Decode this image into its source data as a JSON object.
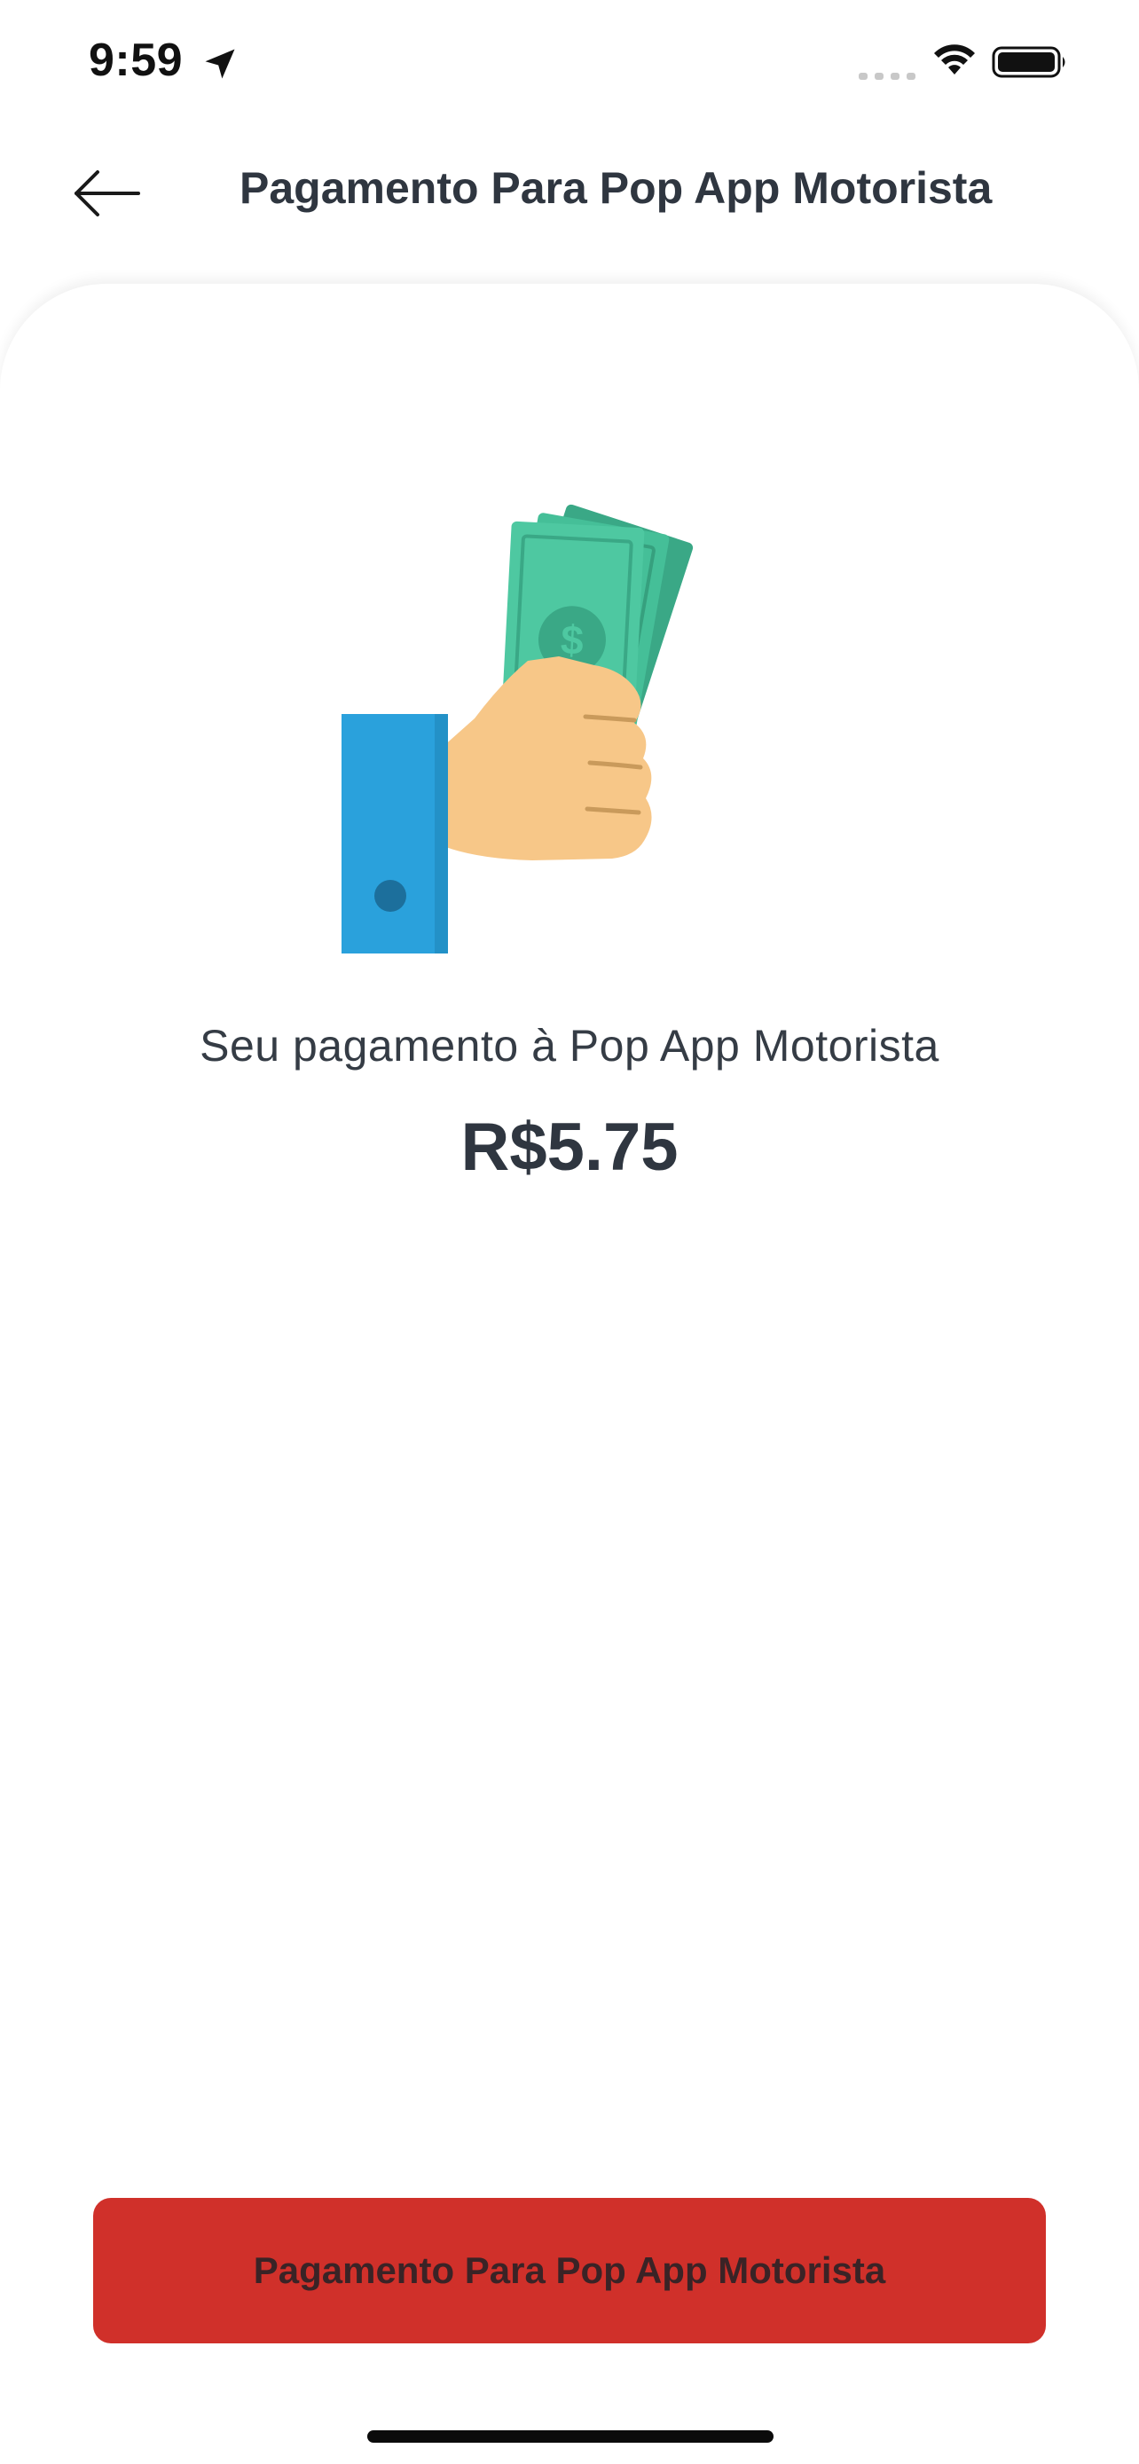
{
  "status_bar": {
    "time": "9:59",
    "location_icon": "location-arrow-icon",
    "signal_icon": "cellular-signal-icon",
    "wifi_icon": "wifi-icon",
    "battery_icon": "battery-icon"
  },
  "header": {
    "back_icon": "arrow-left-icon",
    "title": "Pagamento Para Pop App Motorista"
  },
  "payment": {
    "illustration_icon": "hand-holding-money-icon",
    "subtitle": "Seu pagamento à Pop App Motorista",
    "amount": "R$5.75"
  },
  "footer": {
    "button_label": "Pagamento Para Pop App Motorista"
  },
  "colors": {
    "accent": "#d0302a",
    "text": "#2f3640",
    "background": "#ffffff"
  }
}
